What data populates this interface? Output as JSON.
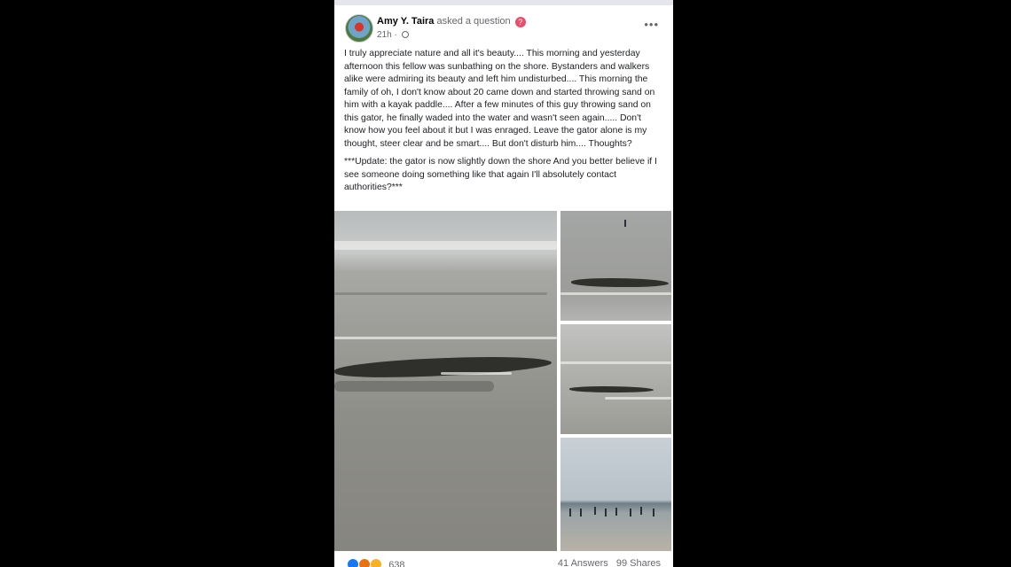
{
  "post": {
    "author": "Amy Y. Taira",
    "action": "asked a question",
    "time": "21h",
    "icons": {
      "question": "question-badge-icon",
      "audience": "globe-icon",
      "menu": "more-options-icon"
    },
    "paragraph1": "I truly appreciate nature and all it's beauty.... This morning and yesterday afternoon this fellow was sunbathing on the shore. Bystanders and walkers alike were admiring its beauty and left him undisturbed.... This morning the family of oh, I don't know about 20 came down and started throwing sand on him with a kayak paddle.... After a few minutes of this guy throwing sand on this gator, he finally waded into the water and wasn't seen again..... Don't know how you feel about it but I was enraged. Leave the gator alone is my thought, steer clear and be smart.... But don't disturb him.... Thoughts?",
    "paragraph2": "***Update: the gator is now slightly down the shore And you better believe if I see someone doing something like that again I'll absolutely contact authorities?***"
  },
  "footer": {
    "reaction_count": "638",
    "answers": "41 Answers",
    "shares": "99 Shares",
    "reaction_icons": [
      "like-icon",
      "angry-icon",
      "sad-icon"
    ]
  },
  "colors": {
    "background": "#000000",
    "card": "#ffffff",
    "like": "#1877f2",
    "question_badge": "#e94d6a"
  }
}
